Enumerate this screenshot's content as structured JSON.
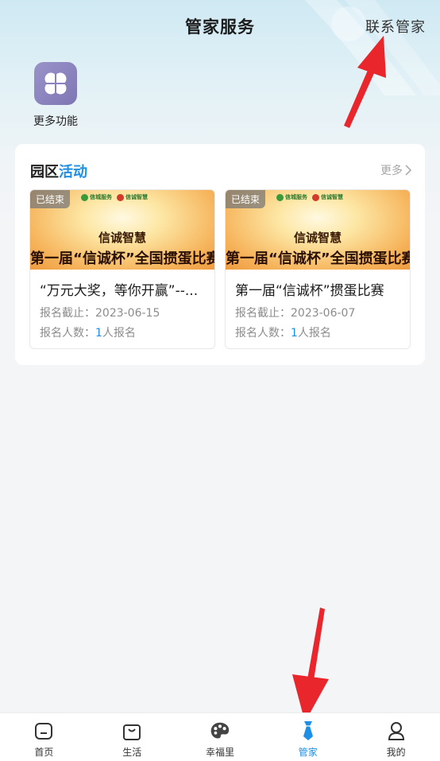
{
  "header": {
    "title": "管家服务",
    "contact": "联系管家"
  },
  "quick": {
    "more_functions": "更多功能",
    "icon": "clover-icon"
  },
  "activities": {
    "title_prefix": "园区",
    "title_highlight": "活动",
    "more": "更多",
    "items": [
      {
        "status": "已结束",
        "logo1": "信城服务",
        "logo2": "信诚智慧",
        "banner_line1": "信诚智慧",
        "banner_line2": "第一届“信诚杯”全国掼蛋比赛",
        "title": "“万元大奖，等你开赢”--...",
        "deadline_label": "报名截止：",
        "deadline": "2023-06-15",
        "count_label": "报名人数：",
        "count": "1",
        "count_suffix": "人报名"
      },
      {
        "status": "已结束",
        "logo1": "信城服务",
        "logo2": "信诚智慧",
        "banner_line1": "信诚智慧",
        "banner_line2": "第一届“信诚杯”全国掼蛋比赛",
        "title": "第一届“信诚杯”掼蛋比赛",
        "deadline_label": "报名截止：",
        "deadline": "2023-06-07",
        "count_label": "报名人数：",
        "count": "1",
        "count_suffix": "人报名"
      }
    ]
  },
  "tabbar": [
    {
      "label": "首页",
      "icon": "home-icon"
    },
    {
      "label": "生活",
      "icon": "shopping-bag-icon"
    },
    {
      "label": "幸福里",
      "icon": "palette-icon"
    },
    {
      "label": "管家",
      "icon": "tie-icon",
      "active": true
    },
    {
      "label": "我的",
      "icon": "user-icon"
    }
  ],
  "colors": {
    "accent": "#1d8fe6",
    "annotation_arrow": "#e8262b"
  }
}
